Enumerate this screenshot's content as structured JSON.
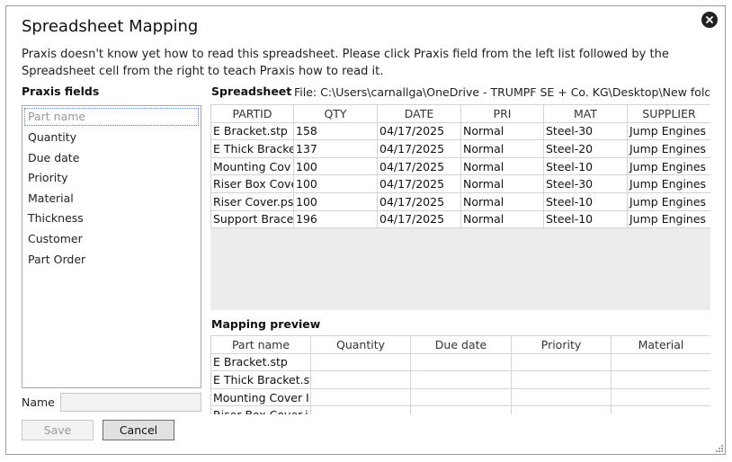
{
  "window": {
    "title": "Spreadsheet Mapping",
    "description": "Praxis doesn't know yet how to read this spreadsheet. Please click Praxis field from the left list followed by the Spreadsheet cell from the right to teach Praxis how to read it."
  },
  "fields": {
    "label": "Praxis fields",
    "items": [
      "Part name",
      "Quantity",
      "Due date",
      "Priority",
      "Material",
      "Thickness",
      "Customer",
      "Part Order"
    ],
    "selected": "Part name"
  },
  "name_field": {
    "label": "Name",
    "value": ""
  },
  "buttons": {
    "save": "Save",
    "cancel": "Cancel"
  },
  "spreadsheet": {
    "label": "Spreadsheet",
    "file": "File: C:\\Users\\carnallga\\OneDrive - TRUMPF SE + Co. KG\\Desktop\\New fold",
    "columns": [
      "PARTID",
      "QTY",
      "DATE",
      "PRI",
      "MAT",
      "SUPPLIER"
    ],
    "rows": [
      [
        "E Bracket.stp",
        "158",
        "04/17/2025",
        "Normal",
        "Steel-30",
        "Jump Engines"
      ],
      [
        "E Thick Bracke",
        "137",
        "04/17/2025",
        "Normal",
        "Steel-20",
        "Jump Engines"
      ],
      [
        "Mounting Cov",
        "100",
        "04/17/2025",
        "Normal",
        "Steel-10",
        "Jump Engines"
      ],
      [
        "Riser Box Cove",
        "100",
        "04/17/2025",
        "Normal",
        "Steel-30",
        "Jump Engines"
      ],
      [
        "Riser Cover.ps",
        "100",
        "04/17/2025",
        "Normal",
        "Steel-10",
        "Jump Engines"
      ],
      [
        "Support Brace",
        "196",
        "04/17/2025",
        "Normal",
        "Steel-10",
        "Jump Engines"
      ]
    ]
  },
  "mapping_preview": {
    "label": "Mapping preview",
    "columns": [
      "Part name",
      "Quantity",
      "Due date",
      "Priority",
      "Material"
    ],
    "rows": [
      [
        "E Bracket.stp",
        "",
        "",
        "",
        ""
      ],
      [
        "E Thick Bracket.st",
        "",
        "",
        "",
        ""
      ],
      [
        "Mounting Cover I",
        "",
        "",
        "",
        ""
      ],
      [
        "Riser Box Cover.i",
        "",
        "",
        "",
        ""
      ]
    ]
  },
  "icons": {
    "close": "close-icon",
    "resize": "resize-grip-icon"
  }
}
